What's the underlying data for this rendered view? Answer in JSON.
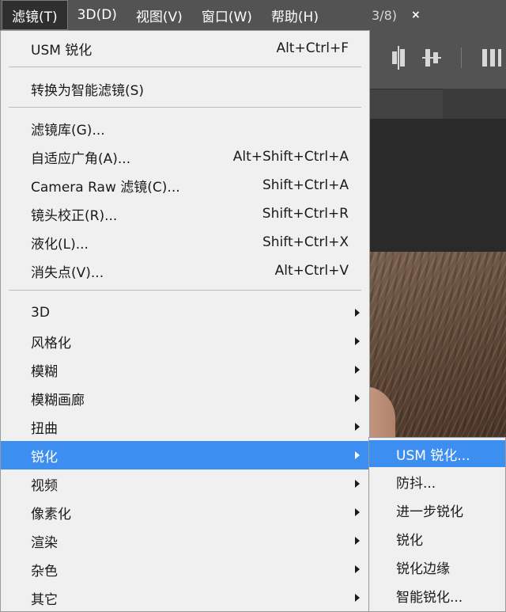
{
  "menubar": {
    "items": [
      {
        "label": "滤镜(T)"
      },
      {
        "label": "3D(D)"
      },
      {
        "label": "视图(V)"
      },
      {
        "label": "窗口(W)"
      },
      {
        "label": "帮助(H)"
      }
    ]
  },
  "document_tab": {
    "title": "3/8)",
    "close": "×"
  },
  "filter_menu": {
    "recent": {
      "label": "USM 锐化",
      "shortcut": "Alt+Ctrl+F"
    },
    "smart": {
      "label": "转换为智能滤镜(S)"
    },
    "filters": [
      {
        "label": "滤镜库(G)...",
        "shortcut": ""
      },
      {
        "label": "自适应广角(A)...",
        "shortcut": "Alt+Shift+Ctrl+A"
      },
      {
        "label": "Camera Raw 滤镜(C)...",
        "shortcut": "Shift+Ctrl+A"
      },
      {
        "label": "镜头校正(R)...",
        "shortcut": "Shift+Ctrl+R"
      },
      {
        "label": "液化(L)...",
        "shortcut": "Shift+Ctrl+X"
      },
      {
        "label": "消失点(V)...",
        "shortcut": "Alt+Ctrl+V"
      }
    ],
    "groups": [
      {
        "label": "3D"
      },
      {
        "label": "风格化"
      },
      {
        "label": "模糊"
      },
      {
        "label": "模糊画廊"
      },
      {
        "label": "扭曲"
      },
      {
        "label": "锐化"
      },
      {
        "label": "视频"
      },
      {
        "label": "像素化"
      },
      {
        "label": "渲染"
      },
      {
        "label": "杂色"
      },
      {
        "label": "其它"
      }
    ]
  },
  "sharpen_submenu": {
    "items": [
      {
        "label": "USM 锐化..."
      },
      {
        "label": "防抖..."
      },
      {
        "label": "进一步锐化"
      },
      {
        "label": "锐化"
      },
      {
        "label": "锐化边缘"
      },
      {
        "label": "智能锐化..."
      }
    ]
  },
  "colors": {
    "highlight": "#3c8ff0",
    "menu_bg": "#f0f0f0",
    "menubar_bg": "#535353"
  }
}
